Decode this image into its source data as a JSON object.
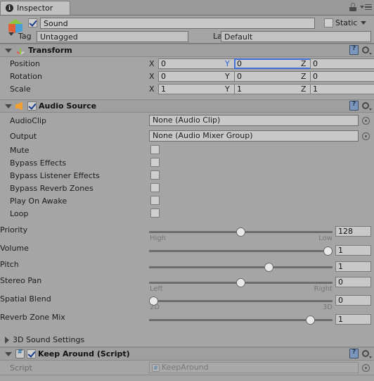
{
  "window": {
    "tab_label": "Inspector",
    "tab_icon": "info-icon",
    "lock_icon": "lock-icon",
    "menu_icon": "hamburger-menu-icon"
  },
  "gameobject": {
    "enabled": true,
    "name": "Sound",
    "static_label": "Static",
    "static_checked": false,
    "tag_label": "Tag",
    "tag_value": "Untagged",
    "layer_label": "Layer",
    "layer_value": "Default"
  },
  "components": [
    {
      "title": "Transform",
      "icon": "transform-axis-icon",
      "expanded": true,
      "has_checkbox": false,
      "rows": [
        {
          "label": "Position",
          "x": "0",
          "y": "0",
          "z": "0",
          "focused_axis": "y"
        },
        {
          "label": "Rotation",
          "x": "0",
          "y": "0",
          "z": "0",
          "focused_axis": ""
        },
        {
          "label": "Scale",
          "x": "1",
          "y": "1",
          "z": "1",
          "focused_axis": ""
        }
      ]
    },
    {
      "title": "Audio Source",
      "icon": "speaker-icon",
      "expanded": true,
      "has_checkbox": true,
      "enabled": true,
      "object_fields": [
        {
          "label": "AudioClip",
          "value": "None (Audio Clip)"
        },
        {
          "label": "Output",
          "value": "None (Audio Mixer Group)"
        }
      ],
      "toggles": [
        {
          "label": "Mute",
          "checked": false
        },
        {
          "label": "Bypass Effects",
          "checked": false
        },
        {
          "label": "Bypass Listener Effects",
          "checked": false
        },
        {
          "label": "Bypass Reverb Zones",
          "checked": false
        },
        {
          "label": "Play On Awake",
          "checked": false
        },
        {
          "label": "Loop",
          "checked": false
        }
      ],
      "sliders": [
        {
          "label": "Priority",
          "value": "128",
          "pct": 50,
          "left_label": "High",
          "right_label": "Low"
        },
        {
          "label": "Volume",
          "value": "1",
          "pct": 100,
          "left_label": "",
          "right_label": ""
        },
        {
          "label": "Pitch",
          "value": "1",
          "pct": 66,
          "left_label": "",
          "right_label": ""
        },
        {
          "label": "Stereo Pan",
          "value": "0",
          "pct": 50,
          "left_label": "Left",
          "right_label": "Right"
        },
        {
          "label": "Spatial Blend",
          "value": "0",
          "pct": 0,
          "left_label": "2D",
          "right_label": "3D"
        },
        {
          "label": "Reverb Zone Mix",
          "value": "1",
          "pct": 90,
          "left_label": "",
          "right_label": ""
        }
      ],
      "foldout": {
        "label": "3D Sound Settings",
        "expanded": false
      }
    },
    {
      "title": "Keep Around (Script)",
      "icon": "csharp-script-icon",
      "expanded": true,
      "has_checkbox": true,
      "enabled": true,
      "script_row": {
        "label": "Script",
        "value": "KeepAround"
      }
    }
  ]
}
